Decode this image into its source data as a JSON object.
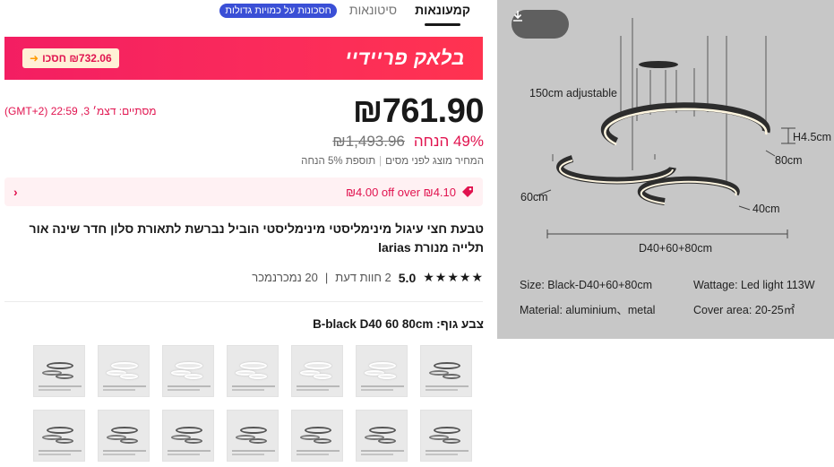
{
  "tabs": {
    "items": [
      "קמעונאות",
      "סיטונאות"
    ],
    "badge": "חסכונות על כמויות גדולות"
  },
  "banner": {
    "title": "בלאק פריידיי",
    "save": "₪732.06 חסכו"
  },
  "price": {
    "current": "₪761.90",
    "original": "₪1,493.96",
    "discount": "49% הנחה",
    "countdown": "מסתיים: דצמ׳ 3, 22:59 (GMT+2)"
  },
  "tax": {
    "note1": "המחיר מוצג לפני מסים",
    "note2": "תוספת 5% הנחה"
  },
  "coupon": {
    "text": "₪4.00 off over ₪4.10"
  },
  "product": {
    "title": "טבעת חצי עיגול מינימליסטי מינימליסטי הוביל נברשת לתאורת סלון חדר שינה אור תלייה מנורת larias"
  },
  "rating": {
    "score": "5.0",
    "reviews": "2 חוות דעת",
    "sold": "20 נמכרנמכר",
    "stars": "★★★★★"
  },
  "variant": {
    "label": "צבע גוף:",
    "value": "B-black D40 60 80cm"
  },
  "thumbnails": {
    "count": 14
  },
  "media": {
    "download_icon": "download-icon",
    "annotations": {
      "adjustable": "150cm adjustable",
      "h": "H4.5cm",
      "d80": "80cm",
      "d60": "60cm",
      "d40": "40cm",
      "total": "D40+60+80cm"
    },
    "specs": {
      "size": "Size: Black-D40+60+80cm",
      "wattage": "Wattage: Led light 113W",
      "material": "Material: aluminium、metal",
      "cover": "Cover area: 20-25㎡"
    }
  },
  "colors": {
    "accent": "#e1134f",
    "banner": "#f31e62",
    "badge": "#3a4fd6",
    "panel": "#c7c7c7"
  }
}
